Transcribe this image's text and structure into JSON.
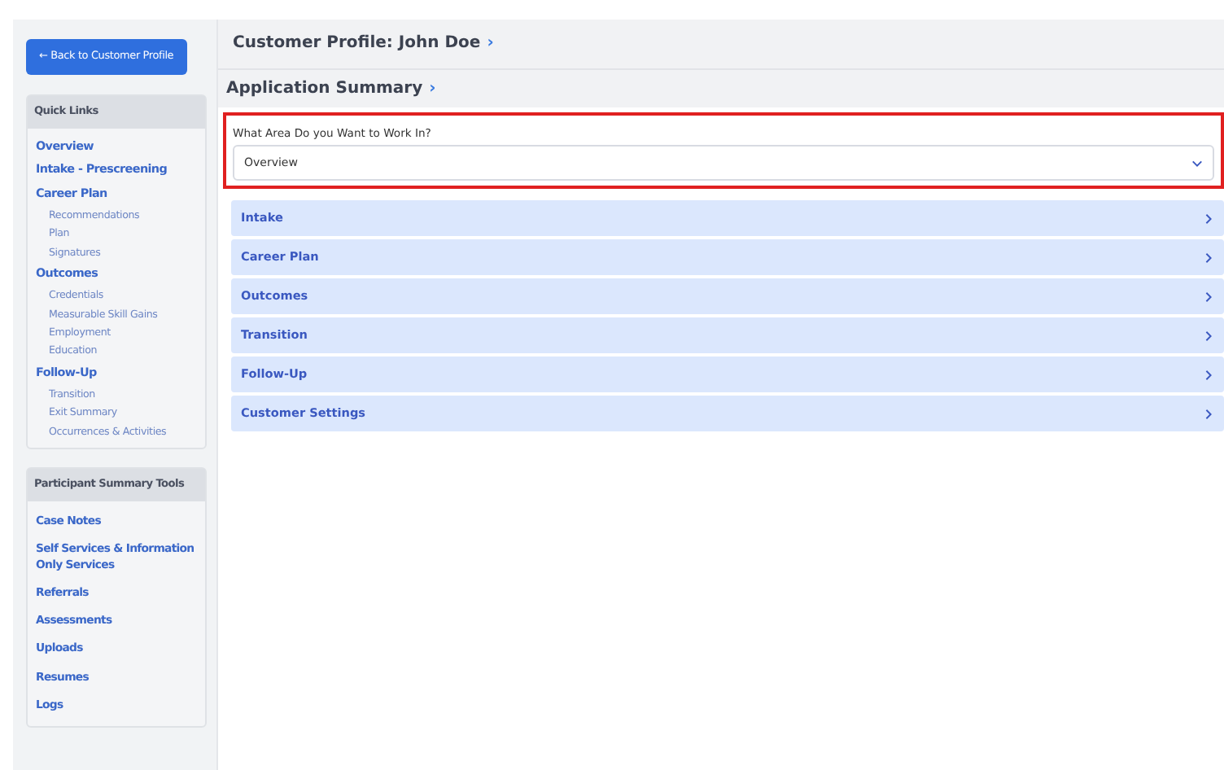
{
  "back_button": {
    "label": "← Back to Customer Profile"
  },
  "quick_links": {
    "title": "Quick Links",
    "items": [
      {
        "label": "Overview"
      },
      {
        "label": "Intake - Prescreening"
      },
      {
        "label": "Career Plan",
        "children": [
          {
            "label": "Recommendations"
          },
          {
            "label": "Plan"
          },
          {
            "label": "Signatures"
          }
        ]
      },
      {
        "label": "Outcomes",
        "children": [
          {
            "label": "Credentials"
          },
          {
            "label": "Measurable Skill Gains"
          },
          {
            "label": "Employment"
          },
          {
            "label": "Education"
          }
        ]
      },
      {
        "label": "Follow-Up",
        "children": [
          {
            "label": "Transition"
          },
          {
            "label": "Exit Summary"
          },
          {
            "label": "Occurrences & Activities"
          }
        ]
      }
    ]
  },
  "tools": {
    "title": "Participant Summary Tools",
    "items": [
      "Case Notes",
      "Self Services & Information Only Services",
      "Referrals",
      "Assessments",
      "Uploads",
      "Resumes",
      "Logs"
    ]
  },
  "breadcrumb": {
    "title": "Customer Profile: John Doe",
    "chevron": "›"
  },
  "section": {
    "title": "Application Summary",
    "chevron": "›"
  },
  "area_select": {
    "label": "What Area Do you Want to Work In?",
    "value": "Overview"
  },
  "accordion": [
    {
      "label": "Intake",
      "expanded": false
    },
    {
      "label": "Career Plan",
      "expanded": false
    },
    {
      "label": "Outcomes",
      "expanded": false
    },
    {
      "label": "Transition",
      "expanded": false
    },
    {
      "label": "Follow-Up",
      "expanded": false
    },
    {
      "label": "Customer Settings",
      "expanded": false
    }
  ]
}
